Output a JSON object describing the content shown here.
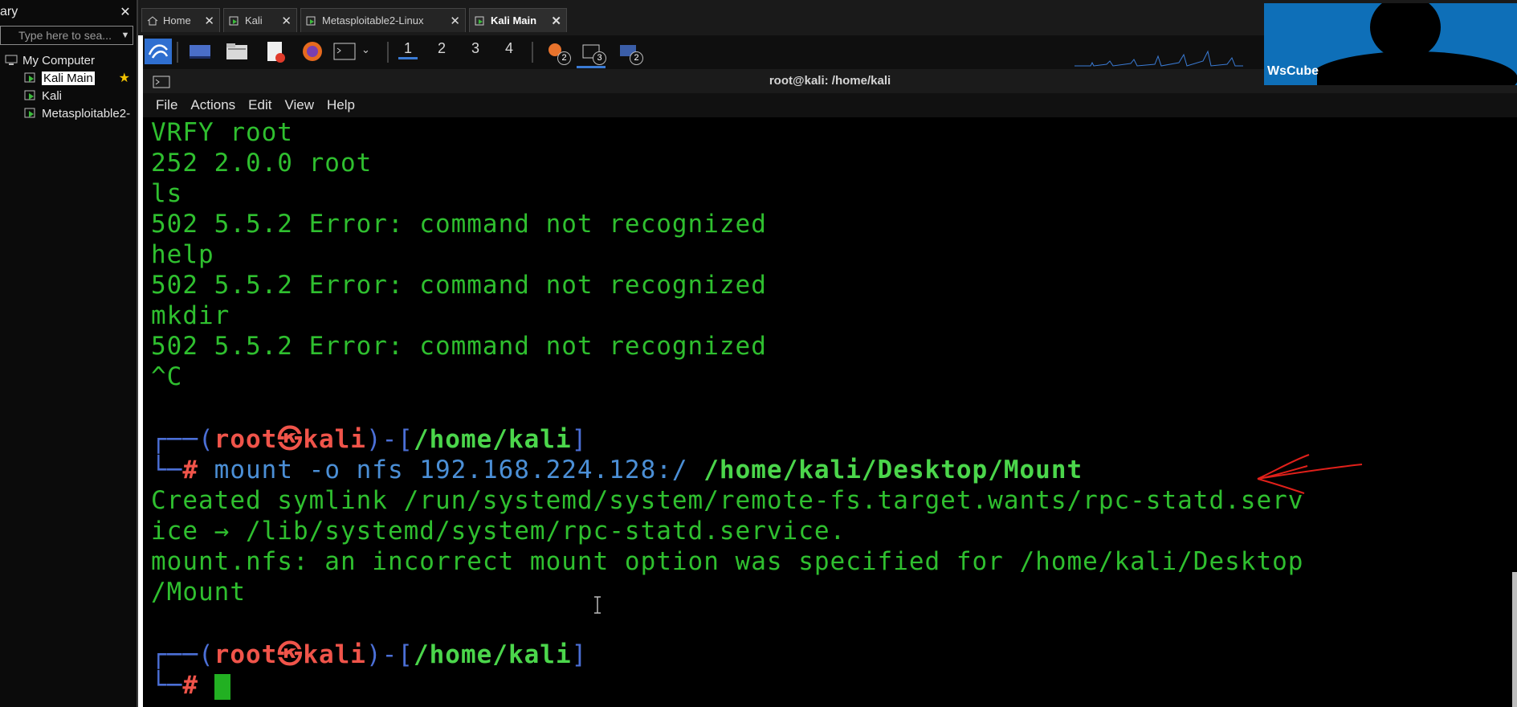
{
  "library": {
    "title": "ary",
    "close": "✕",
    "search_placeholder": "Type here to sea...",
    "root": "My Computer",
    "vms": [
      {
        "label": "Kali Main",
        "selected": true,
        "favorite": true
      },
      {
        "label": "Kali",
        "selected": false,
        "favorite": false
      },
      {
        "label": "Metasploitable2-",
        "selected": false,
        "favorite": false
      }
    ]
  },
  "tabs": [
    {
      "label": "Home",
      "icon": "home-icon",
      "active": false
    },
    {
      "label": "Kali",
      "icon": "vm-icon",
      "active": false
    },
    {
      "label": "Metasploitable2-Linux",
      "icon": "vm-icon",
      "active": false
    },
    {
      "label": "Kali Main",
      "icon": "vm-icon",
      "active": true
    }
  ],
  "tab_close": "✕",
  "panel": {
    "workspaces": [
      "1",
      "2",
      "3",
      "4"
    ],
    "active_workspace": "1",
    "badges": [
      "2",
      "3",
      "2"
    ]
  },
  "webcam": {
    "brand": "WsCube"
  },
  "terminal": {
    "title": "root@kali: /home/kali",
    "menu": [
      "File",
      "Actions",
      "Edit",
      "View",
      "Help"
    ],
    "lines": [
      "VRFY root",
      "252 2.0.0 root",
      "ls",
      "502 5.5.2 Error: command not recognized",
      "help",
      "502 5.5.2 Error: command not recognized",
      "mkdir",
      "502 5.5.2 Error: command not recognized",
      "^C"
    ],
    "prompt": {
      "open": "┌──(",
      "user": "root",
      "at": "㉿",
      "host": "kali",
      "mid": ")-[",
      "path": "/home/kali",
      "close": "]",
      "hash_prefix": "└─",
      "hash": "#"
    },
    "command_plain": "mount -o nfs 192.168.224.128:/ ",
    "command_bold": "/home/kali/Desktop/Mount",
    "output": [
      "Created symlink /run/systemd/system/remote-fs.target.wants/rpc-statd.serv",
      "ice → /lib/systemd/system/rpc-statd.service.",
      "mount.nfs: an incorrect mount option was specified for /home/kali/Desktop",
      "/Mount"
    ]
  },
  "colors": {
    "terminal_green": "#2fbf2f",
    "prompt_red": "#f0544a",
    "prompt_blue": "#4b6fd6",
    "annotation_red": "#e0201a",
    "webcam_blue": "#0e6fb8"
  }
}
